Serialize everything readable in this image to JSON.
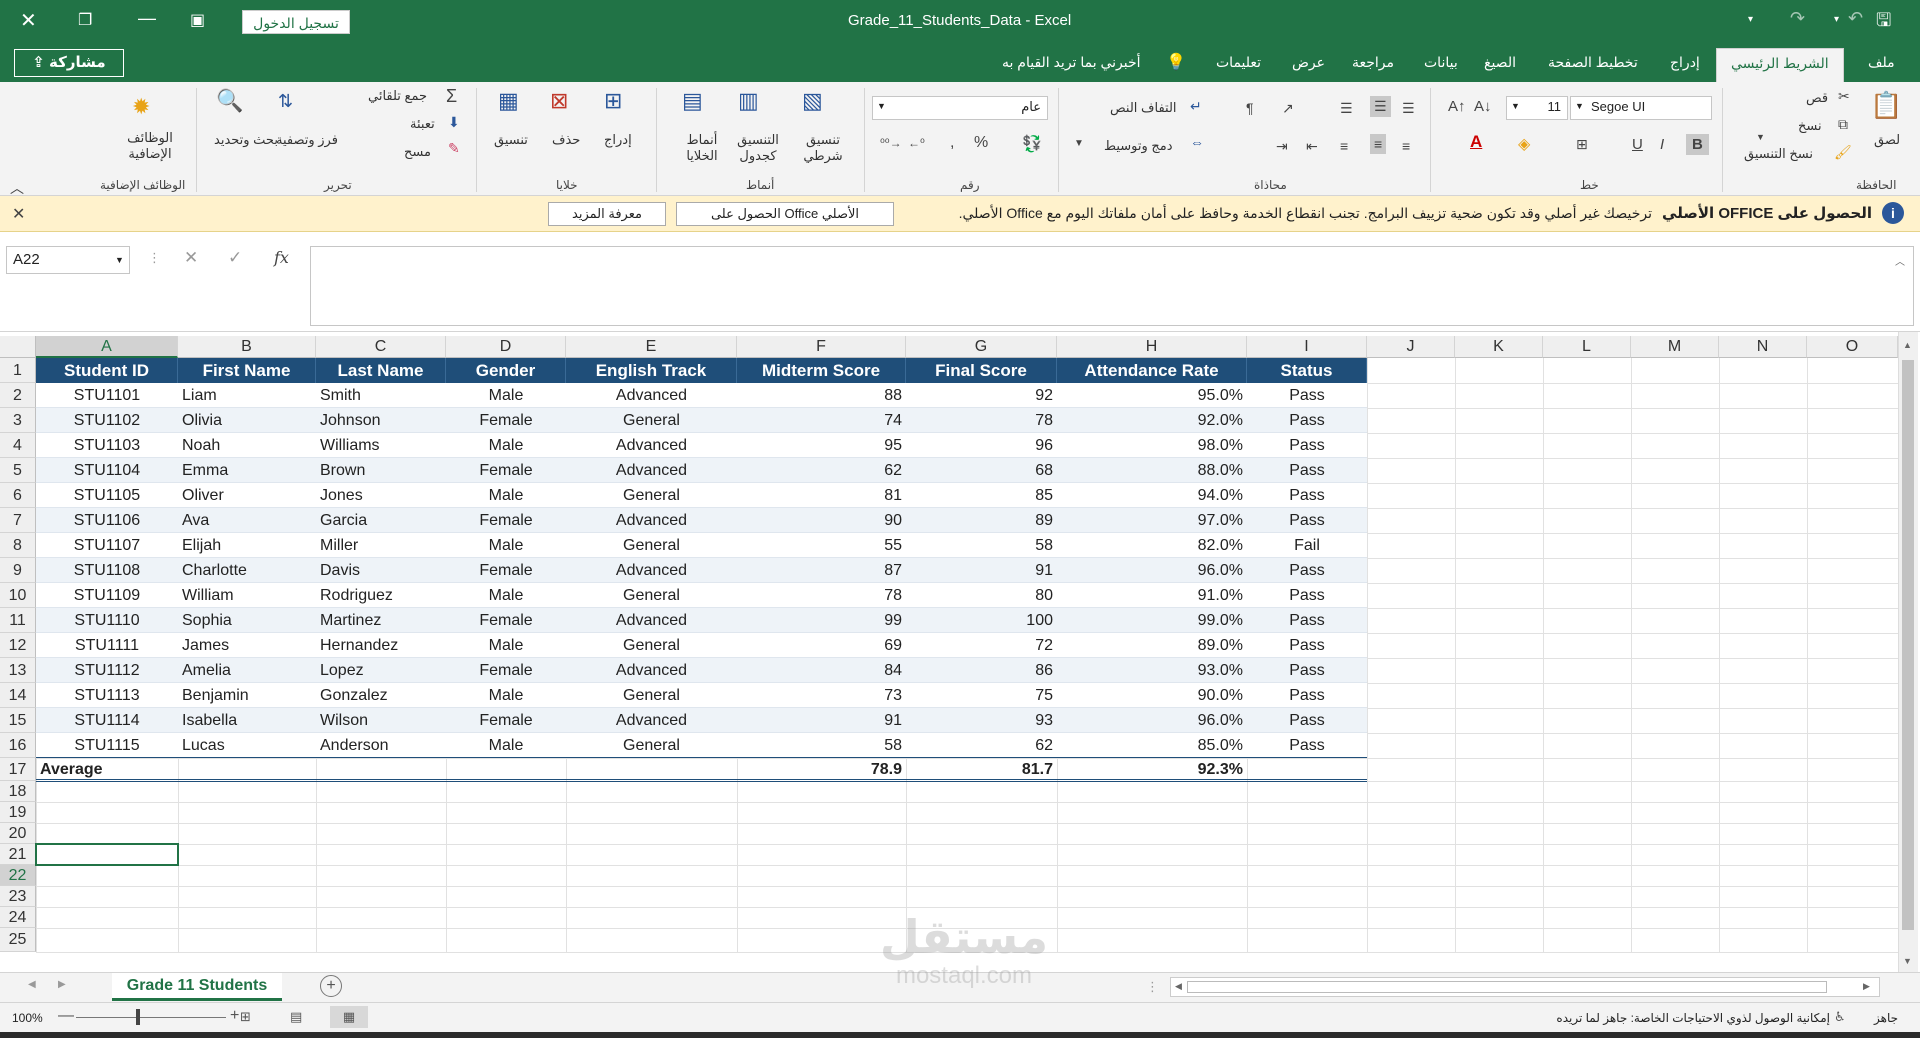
{
  "window": {
    "title": "Grade_11_Students_Data  -  Excel",
    "signin": "تسجيل الدخول"
  },
  "tabs": {
    "file": "ملف",
    "home": "الشريط الرئيسي",
    "insert": "إدراج",
    "layout": "تخطيط الصفحة",
    "formulas": "الصيغ",
    "data": "بيانات",
    "review": "مراجعة",
    "view": "عرض",
    "help": "تعليمات",
    "tellme": "أخبرني بما تريد القيام به",
    "share": "مشاركة"
  },
  "ribbon": {
    "clipboard": {
      "paste": "لصق",
      "cut": "قص",
      "copy": "نسخ",
      "format_painter": "نسخ التنسيق",
      "group": "الحافظة"
    },
    "font": {
      "name": "Segoe UI",
      "size": "11",
      "group": "خط"
    },
    "alignment": {
      "wrap": "التفاف النص",
      "merge": "دمج وتوسيط",
      "group": "محاذاة"
    },
    "number": {
      "format": "عام",
      "group": "رقم"
    },
    "styles": {
      "conditional": "تنسيق شرطي",
      "table": "التنسيق كجدول",
      "cell": "أنماط الخلايا",
      "group": "أنماط"
    },
    "cells": {
      "insert": "إدراج",
      "delete": "حذف",
      "format": "تنسيق",
      "group": "خلايا"
    },
    "editing": {
      "autosum": "جمع تلقائي",
      "fill": "تعبئة",
      "clear": "مسح",
      "sort": "فرز وتصفية",
      "find": "بحث وتحديد",
      "group": "تحرير"
    },
    "addins": {
      "label": "الوظائف الإضافية",
      "group": "الوظائف الإضافية"
    }
  },
  "message": {
    "title": "الحصول على OFFICE الأصلي",
    "text": "ترخيصك غير أصلي وقد تكون ضحية تزييف البرامج. تجنب انقطاع الخدمة وحافظ على أمان ملفاتك اليوم مع Office الأصلي.",
    "btn_get": "الحصول على Office الأصلي",
    "btn_more": "معرفة المزيد"
  },
  "formula": {
    "namebox": "A22",
    "fx": "fx"
  },
  "columns": [
    "A",
    "B",
    "C",
    "D",
    "E",
    "F",
    "G",
    "H",
    "I",
    "J",
    "K",
    "L",
    "M",
    "N",
    "O"
  ],
  "headers": [
    "Student ID",
    "First Name",
    "Last Name",
    "Gender",
    "English Track",
    "Midterm Score",
    "Final Score",
    "Attendance Rate",
    "Status"
  ],
  "rows": [
    [
      "STU1101",
      "Liam",
      "Smith",
      "Male",
      "Advanced",
      "88",
      "92",
      "95.0%",
      "Pass"
    ],
    [
      "STU1102",
      "Olivia",
      "Johnson",
      "Female",
      "General",
      "74",
      "78",
      "92.0%",
      "Pass"
    ],
    [
      "STU1103",
      "Noah",
      "Williams",
      "Male",
      "Advanced",
      "95",
      "96",
      "98.0%",
      "Pass"
    ],
    [
      "STU1104",
      "Emma",
      "Brown",
      "Female",
      "Advanced",
      "62",
      "68",
      "88.0%",
      "Pass"
    ],
    [
      "STU1105",
      "Oliver",
      "Jones",
      "Male",
      "General",
      "81",
      "85",
      "94.0%",
      "Pass"
    ],
    [
      "STU1106",
      "Ava",
      "Garcia",
      "Female",
      "Advanced",
      "90",
      "89",
      "97.0%",
      "Pass"
    ],
    [
      "STU1107",
      "Elijah",
      "Miller",
      "Male",
      "General",
      "55",
      "58",
      "82.0%",
      "Fail"
    ],
    [
      "STU1108",
      "Charlotte",
      "Davis",
      "Female",
      "Advanced",
      "87",
      "91",
      "96.0%",
      "Pass"
    ],
    [
      "STU1109",
      "William",
      "Rodriguez",
      "Male",
      "General",
      "78",
      "80",
      "91.0%",
      "Pass"
    ],
    [
      "STU1110",
      "Sophia",
      "Martinez",
      "Female",
      "Advanced",
      "99",
      "100",
      "99.0%",
      "Pass"
    ],
    [
      "STU1111",
      "James",
      "Hernandez",
      "Male",
      "General",
      "69",
      "72",
      "89.0%",
      "Pass"
    ],
    [
      "STU1112",
      "Amelia",
      "Lopez",
      "Female",
      "Advanced",
      "84",
      "86",
      "93.0%",
      "Pass"
    ],
    [
      "STU1113",
      "Benjamin",
      "Gonzalez",
      "Male",
      "General",
      "73",
      "75",
      "90.0%",
      "Pass"
    ],
    [
      "STU1114",
      "Isabella",
      "Wilson",
      "Female",
      "Advanced",
      "91",
      "93",
      "96.0%",
      "Pass"
    ],
    [
      "STU1115",
      "Lucas",
      "Anderson",
      "Male",
      "General",
      "58",
      "62",
      "85.0%",
      "Pass"
    ]
  ],
  "average": {
    "label": "Average",
    "midterm": "78.9",
    "final": "81.7",
    "attendance": "92.3%"
  },
  "row_numbers": [
    "1",
    "2",
    "3",
    "4",
    "5",
    "6",
    "7",
    "8",
    "9",
    "10",
    "11",
    "12",
    "13",
    "14",
    "15",
    "16",
    "17",
    "18",
    "19",
    "20",
    "21",
    "22",
    "23",
    "24",
    "25"
  ],
  "sheet": {
    "tab": "Grade 11 Students"
  },
  "status": {
    "ready": "جاهز",
    "accessibility": "إمكانية الوصول لذوي الاحتياجات الخاصة: جاهز لما تريده",
    "zoom": "100%"
  },
  "watermark": {
    "logo": "مستقل",
    "url": "mostaql.com"
  }
}
